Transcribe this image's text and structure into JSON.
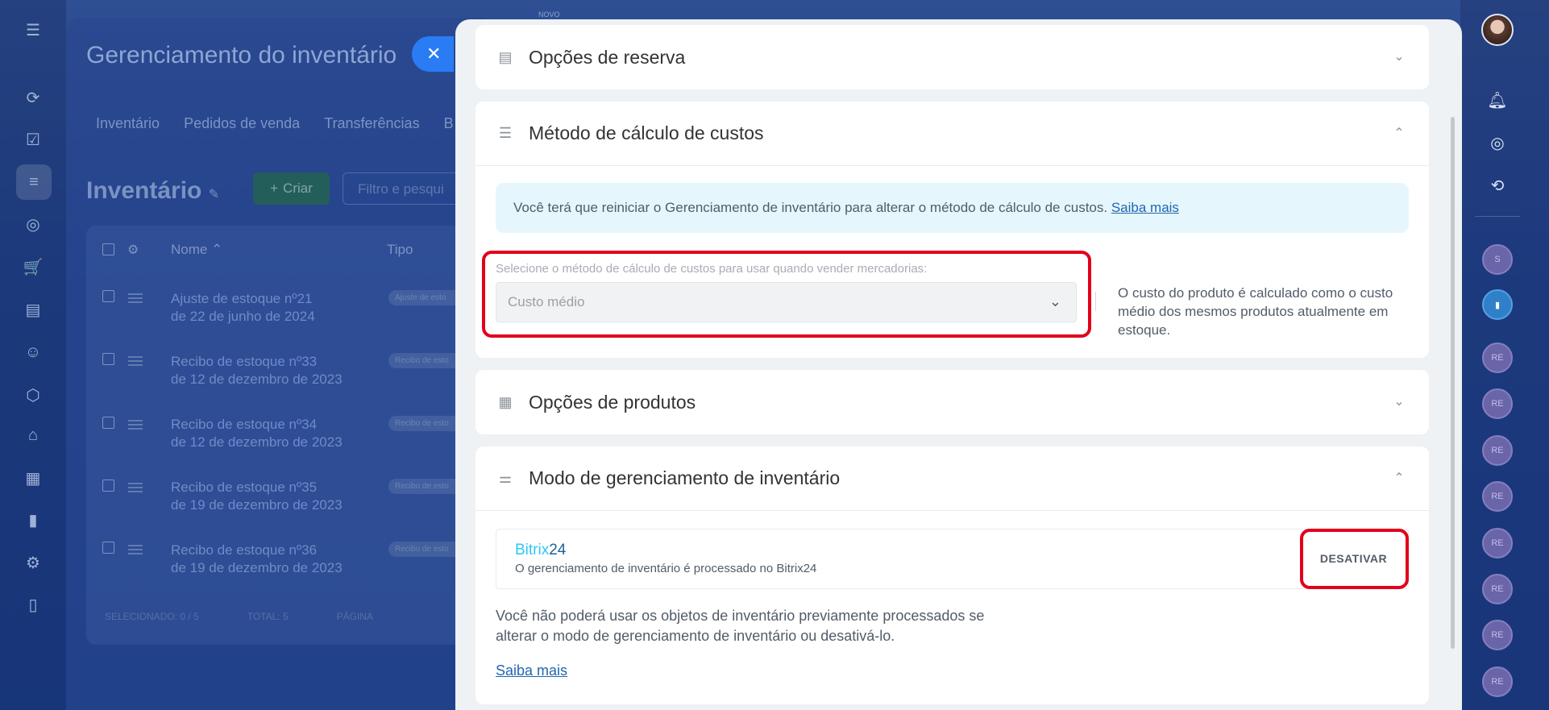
{
  "background_app": {
    "novo_label": "NOVO",
    "title": "Gerenciamento do inventário",
    "tabs": [
      "Inventário",
      "Pedidos de venda",
      "Transferências",
      "B"
    ],
    "heading": "Inventário",
    "create_label": "Criar",
    "filter_placeholder": "Filtro e pesqui",
    "columns": {
      "name": "Nome",
      "type": "Tipo"
    },
    "rows": [
      {
        "line1": "Ajuste de estoque nº21",
        "line2": "de 22 de junho de 2024",
        "badge": "Ajuste de esto"
      },
      {
        "line1": "Recibo de estoque nº33",
        "line2": "de 12 de dezembro de 2023",
        "badge": "Recibo de esto"
      },
      {
        "line1": "Recibo de estoque nº34",
        "line2": "de 12 de dezembro de 2023",
        "badge": "Recibo de esto"
      },
      {
        "line1": "Recibo de estoque nº35",
        "line2": "de 19 de dezembro de 2023",
        "badge": "Recibo de esto"
      },
      {
        "line1": "Recibo de estoque nº36",
        "line2": "de 19 de dezembro de 2023",
        "badge": "Recibo de esto"
      }
    ],
    "footer": {
      "selected": "SELECIONADO: 0 / 5",
      "total": "TOTAL: 5",
      "page": "PÁGINA"
    }
  },
  "right_rail": {
    "avatars": [
      "S",
      "RE",
      "RE",
      "RE",
      "RE",
      "RE",
      "RE",
      "RE",
      "RE"
    ]
  },
  "sections": {
    "reserve": {
      "title": "Opções de reserva"
    },
    "cost_method": {
      "title": "Método de cálculo de custos",
      "info_text": "Você terá que reiniciar o Gerenciamento de inventário para alterar o método de cálculo de custos.",
      "info_link": "Saiba mais",
      "select_label": "Selecione o método de cálculo de custos para usar quando vender mercadorias:",
      "select_value": "Custo médio",
      "description": "O custo do produto é calculado como o custo médio dos mesmos produtos atualmente em estoque."
    },
    "products": {
      "title": "Opções de produtos"
    },
    "mode": {
      "title": "Modo de gerenciamento de inventário",
      "provider_name_a": "Bitrix",
      "provider_name_b": "24",
      "provider_desc": "O gerenciamento de inventário é processado no Bitrix24",
      "deactivate_label": "DESATIVAR",
      "warning": "Você não poderá usar os objetos de inventário previamente processados se alterar o modo de gerenciamento de inventário ou desativá-lo.",
      "learn_more": "Saiba mais"
    }
  },
  "colors": {
    "highlight": "#e2001a",
    "link": "#2067b0",
    "info_bg": "#e5f7fd"
  }
}
